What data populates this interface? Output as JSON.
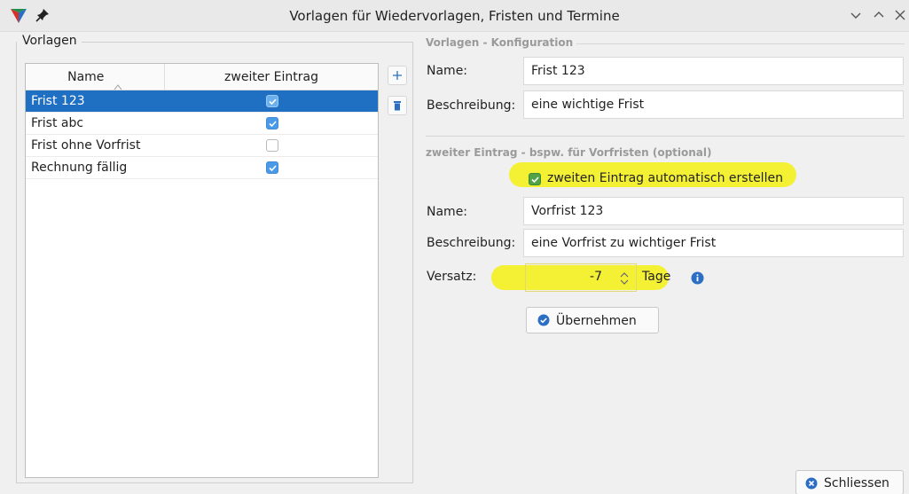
{
  "window": {
    "title": "Vorlagen für Wiedervorlagen, Fristen und Termine",
    "controls": [
      "chevron-down-icon",
      "chevron-up-icon",
      "close-icon"
    ]
  },
  "left_panel": {
    "legend": "Vorlagen",
    "table": {
      "columns": [
        "Name",
        "zweiter Eintrag"
      ],
      "rows": [
        {
          "name": "Frist 123",
          "zweiter_eintrag": true,
          "selected": true
        },
        {
          "name": "Frist abc",
          "zweiter_eintrag": true,
          "selected": false
        },
        {
          "name": "Frist ohne Vorfrist",
          "zweiter_eintrag": false,
          "selected": false
        },
        {
          "name": "Rechnung fällig",
          "zweiter_eintrag": true,
          "selected": false
        }
      ]
    },
    "buttons": [
      "plus-icon",
      "trash-icon"
    ]
  },
  "config": {
    "section_title": "Vorlagen - Konfiguration",
    "name_label": "Name:",
    "name_value": "Frist 123",
    "beschreibung_label": "Beschreibung:",
    "beschreibung_value": "eine wichtige Frist"
  },
  "second_entry": {
    "section_title": "zweiter Eintrag - bspw. für Vorfristen (optional)",
    "auto_create_label": "zweiten Eintrag automatisch erstellen",
    "auto_create_checked": true,
    "name_label": "Name:",
    "name_value": "Vorfrist 123",
    "beschreibung_label": "Beschreibung:",
    "beschreibung_value": "eine Vorfrist zu wichtiger Frist",
    "versatz_label": "Versatz:",
    "versatz_value": "-7",
    "versatz_unit": "Tage",
    "apply_label": "Übernehmen"
  },
  "footer": {
    "close_label": "Schliessen"
  },
  "colors": {
    "selection": "#1f6fc3",
    "highlight": "#f3f02a",
    "accent_blue": "#2b6fc4",
    "check_green": "#54a248"
  }
}
